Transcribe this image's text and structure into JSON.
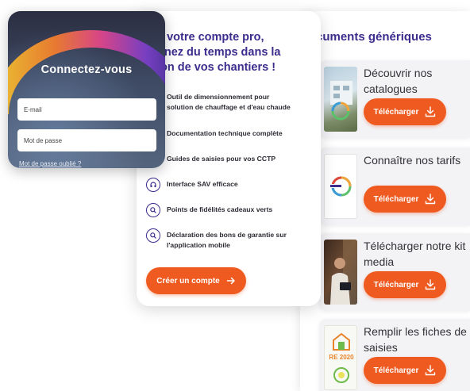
{
  "colors": {
    "accent": "#ee5a1f",
    "brand": "#3d2c8d",
    "text": "#333338"
  },
  "login": {
    "title": "Connectez-vous",
    "email_placeholder": "E-mail",
    "password_placeholder": "Mot de passe",
    "forgot_link": "Mot de passe oublié ?"
  },
  "pro": {
    "title_lines": [
      "c votre compte pro,",
      "gnez du temps dans la",
      "ion de vos chantiers !"
    ],
    "features": [
      {
        "icon": "check-circle-icon",
        "text_lines": [
          "Outil de dimensionnement pour",
          "solution de chauffage et d'eau chaude"
        ]
      },
      {
        "icon": "document-circle-icon",
        "text_lines": [
          "Documentation technique complète"
        ]
      },
      {
        "icon": "book-circle-icon",
        "text_lines": [
          "Guides de saisies pour vos CCTP"
        ]
      },
      {
        "icon": "headset-circle-icon",
        "text_lines": [
          "Interface SAV efficace"
        ]
      },
      {
        "icon": "search-circle-icon",
        "text_lines": [
          "Points de fidélités cadeaux verts"
        ]
      },
      {
        "icon": "search-circle-icon",
        "text_lines": [
          "Déclaration des bons de garantie sur",
          "l'application mobile"
        ]
      }
    ],
    "create_button": "Créer un compte"
  },
  "docs": {
    "title": "cuments génériques",
    "items": [
      {
        "label": "Découvrir nos catalogues",
        "button": "Télécharger",
        "thumb_icon": "catalogue-cover-icon"
      },
      {
        "label": "Connaître nos tarifs",
        "button": "Télécharger",
        "thumb_icon": "tarifs-cover-icon"
      },
      {
        "label": "Télécharger notre kit media",
        "button": "Télécharger",
        "thumb_icon": "media-photo-icon"
      },
      {
        "label": "Remplir les fiches de saisies",
        "button": "Télécharger",
        "thumb_icon": "re2020-badge-icon",
        "badge_text": "RE 2020"
      }
    ]
  }
}
